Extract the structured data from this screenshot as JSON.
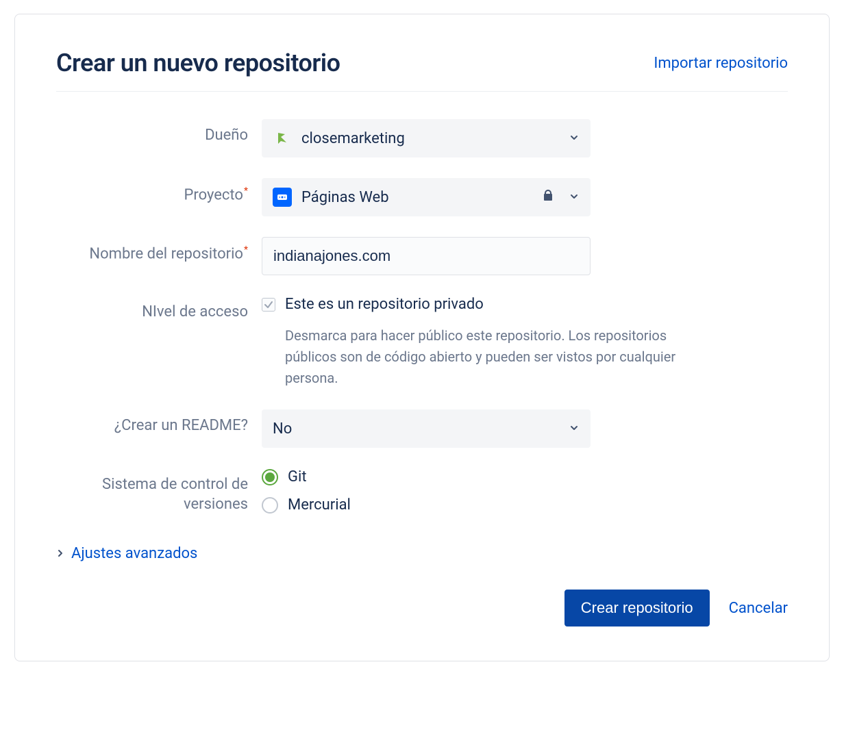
{
  "header": {
    "title": "Crear un nuevo repositorio",
    "import_link": "Importar repositorio"
  },
  "form": {
    "owner_label": "Dueño",
    "owner_value": "closemarketing",
    "project_label": "Proyecto",
    "project_value": "Páginas Web",
    "repo_name_label": "Nombre del repositorio",
    "repo_name_value": "indianajones.com",
    "access_label": "NIvel de acceso",
    "access_checkbox_label": "Este es un repositorio privado",
    "access_help": "Desmarca para hacer público este repositorio. Los repositorios públicos son de código abierto y pueden ser vistos por cualquier persona.",
    "readme_label": "¿Crear un README?",
    "readme_value": "No",
    "vcs_label": "Sistema de control de versiones",
    "vcs_git": "Git",
    "vcs_mercurial": "Mercurial",
    "advanced_label": "Ajustes avanzados"
  },
  "footer": {
    "create_btn": "Crear repositorio",
    "cancel_btn": "Cancelar"
  }
}
